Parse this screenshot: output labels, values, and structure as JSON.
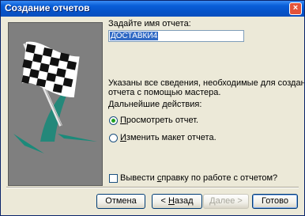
{
  "window": {
    "title": "Создание отчетов"
  },
  "name_prompt": "Задайте имя отчета:",
  "name_value": "ДОСТАВКИ4",
  "info_line1": "Указаны все сведения, необходимые для создания",
  "info_line2": "отчета с помощью мастера.",
  "next_actions": "Дальнейшие действия:",
  "options": {
    "preview": {
      "prefix": "",
      "hot": "П",
      "rest": "росмотреть отчет.",
      "selected": true
    },
    "modify": {
      "prefix": "",
      "hot": "И",
      "rest": "зменить макет отчета.",
      "selected": false
    }
  },
  "help_checkbox": {
    "prefix": "Вывести ",
    "hot": "с",
    "rest": "правку по работе с отчетом?",
    "checked": false
  },
  "buttons": {
    "cancel": "Отмена",
    "back_arrow": "< ",
    "back_hot": "Н",
    "back_rest": "азад",
    "next_label": "Далее >",
    "finish": "Готово"
  },
  "colors": {
    "accent": "#0a5fd8",
    "flag_teal": "#1b8a7a"
  }
}
